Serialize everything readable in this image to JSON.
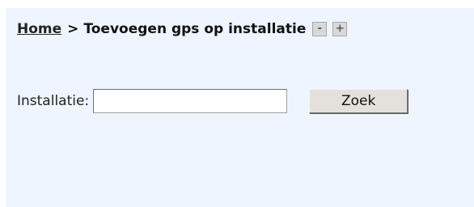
{
  "breadcrumb": {
    "home_label": "Home",
    "separator": ">",
    "current": "Toevoegen gps op installatie"
  },
  "zoom": {
    "minus_label": "-",
    "plus_label": "+"
  },
  "form": {
    "installation_label": "Installatie:",
    "installation_value": "",
    "search_button_label": "Zoek"
  },
  "colors": {
    "panel_background": "#eef5ff",
    "button_background": "#e4e1dc",
    "zoom_button_background": "#d8d8d8"
  }
}
